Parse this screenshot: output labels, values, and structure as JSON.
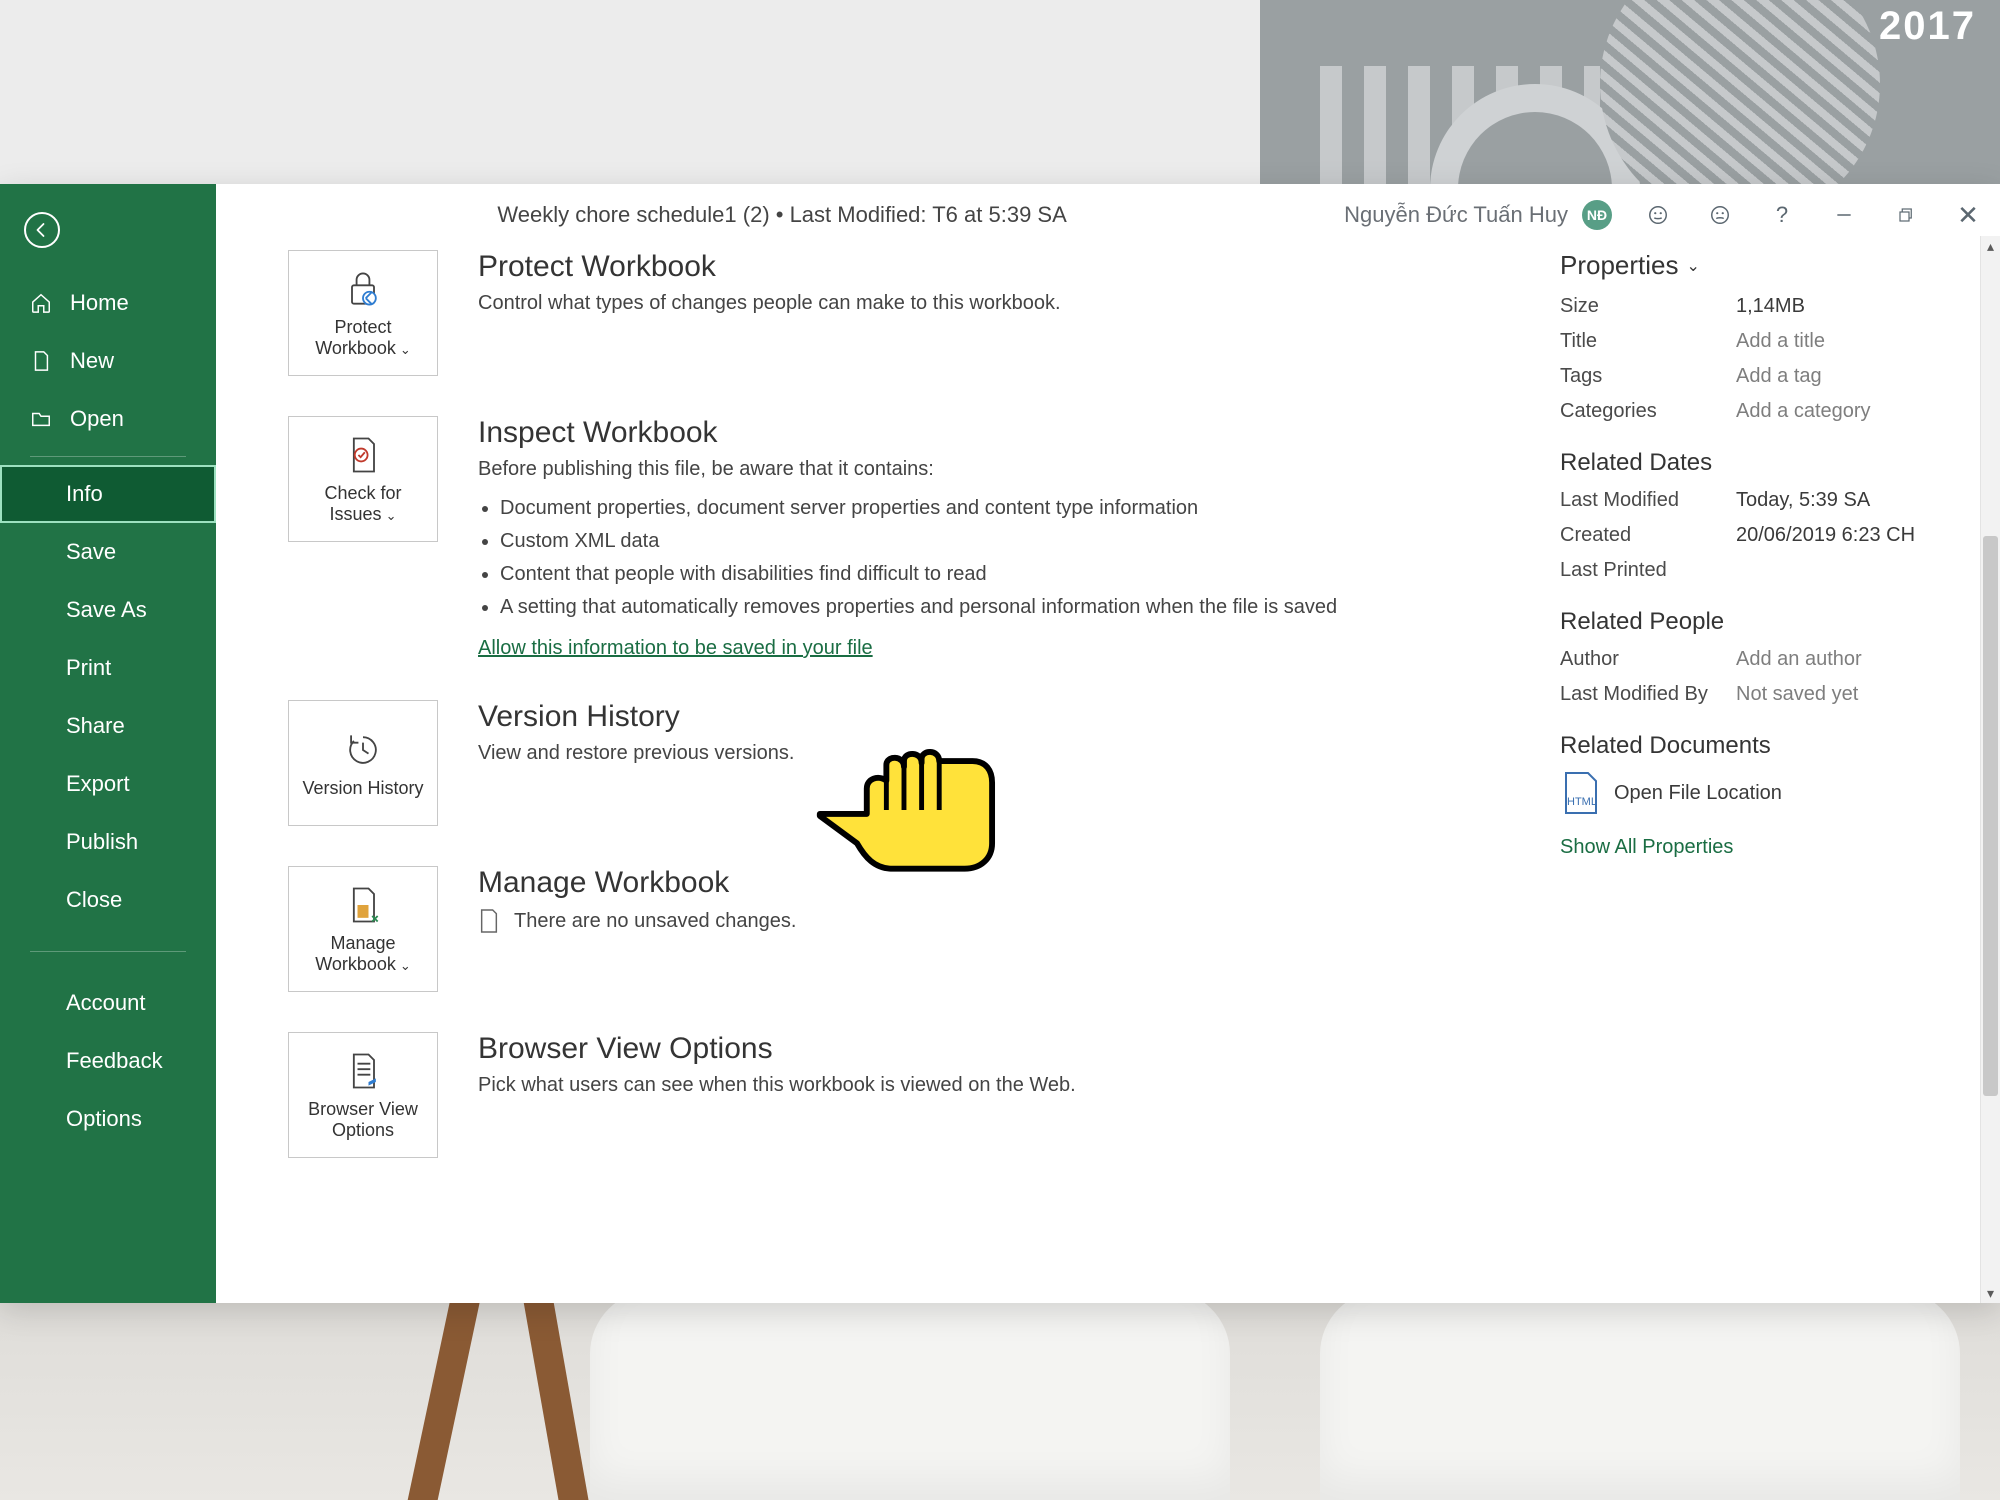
{
  "titlebar": {
    "doc_title": "Weekly chore schedule1 (2) • Last Modified: T6 at 5:39 SA",
    "user_name": "Nguyễn Đức Tuấn Huy",
    "user_initials": "NĐ"
  },
  "sidebar": {
    "home": "Home",
    "new": "New",
    "open": "Open",
    "info": "Info",
    "save": "Save",
    "save_as": "Save As",
    "print": "Print",
    "share": "Share",
    "export": "Export",
    "publish": "Publish",
    "close": "Close",
    "account": "Account",
    "feedback": "Feedback",
    "options": "Options"
  },
  "sections": {
    "protect": {
      "tile": "Protect Workbook",
      "title": "Protect Workbook",
      "desc": "Control what types of changes people can make to this workbook."
    },
    "inspect": {
      "tile": "Check for Issues",
      "title": "Inspect Workbook",
      "desc": "Before publishing this file, be aware that it contains:",
      "items": [
        "Document properties, document server properties and content type information",
        "Custom XML data",
        "Content that people with disabilities find difficult to read",
        "A setting that automatically removes properties and personal information when the file is saved"
      ],
      "link": "Allow this information to be saved in your file"
    },
    "version": {
      "tile": "Version History",
      "title": "Version History",
      "desc": "View and restore previous versions."
    },
    "manage": {
      "tile": "Manage Workbook",
      "title": "Manage Workbook",
      "desc": "There are no unsaved changes."
    },
    "browser": {
      "tile": "Browser View Options",
      "title": "Browser View Options",
      "desc": "Pick what users can see when this workbook is viewed on the Web."
    }
  },
  "properties": {
    "heading": "Properties",
    "size_k": "Size",
    "size_v": "1,14MB",
    "title_k": "Title",
    "title_v": "Add a title",
    "tags_k": "Tags",
    "tags_v": "Add a tag",
    "categories_k": "Categories",
    "categories_v": "Add a category",
    "dates_heading": "Related Dates",
    "last_modified_k": "Last Modified",
    "last_modified_v": "Today, 5:39 SA",
    "created_k": "Created",
    "created_v": "20/06/2019 6:23 CH",
    "last_printed_k": "Last Printed",
    "last_printed_v": "",
    "people_heading": "Related People",
    "author_k": "Author",
    "author_v": "Add an author",
    "lastmodby_k": "Last Modified By",
    "lastmodby_v": "Not saved yet",
    "docs_heading": "Related Documents",
    "file_icon_text": "HTML",
    "open_file": "Open File Location",
    "show_all": "Show All Properties"
  },
  "bg": {
    "year": "2017"
  }
}
